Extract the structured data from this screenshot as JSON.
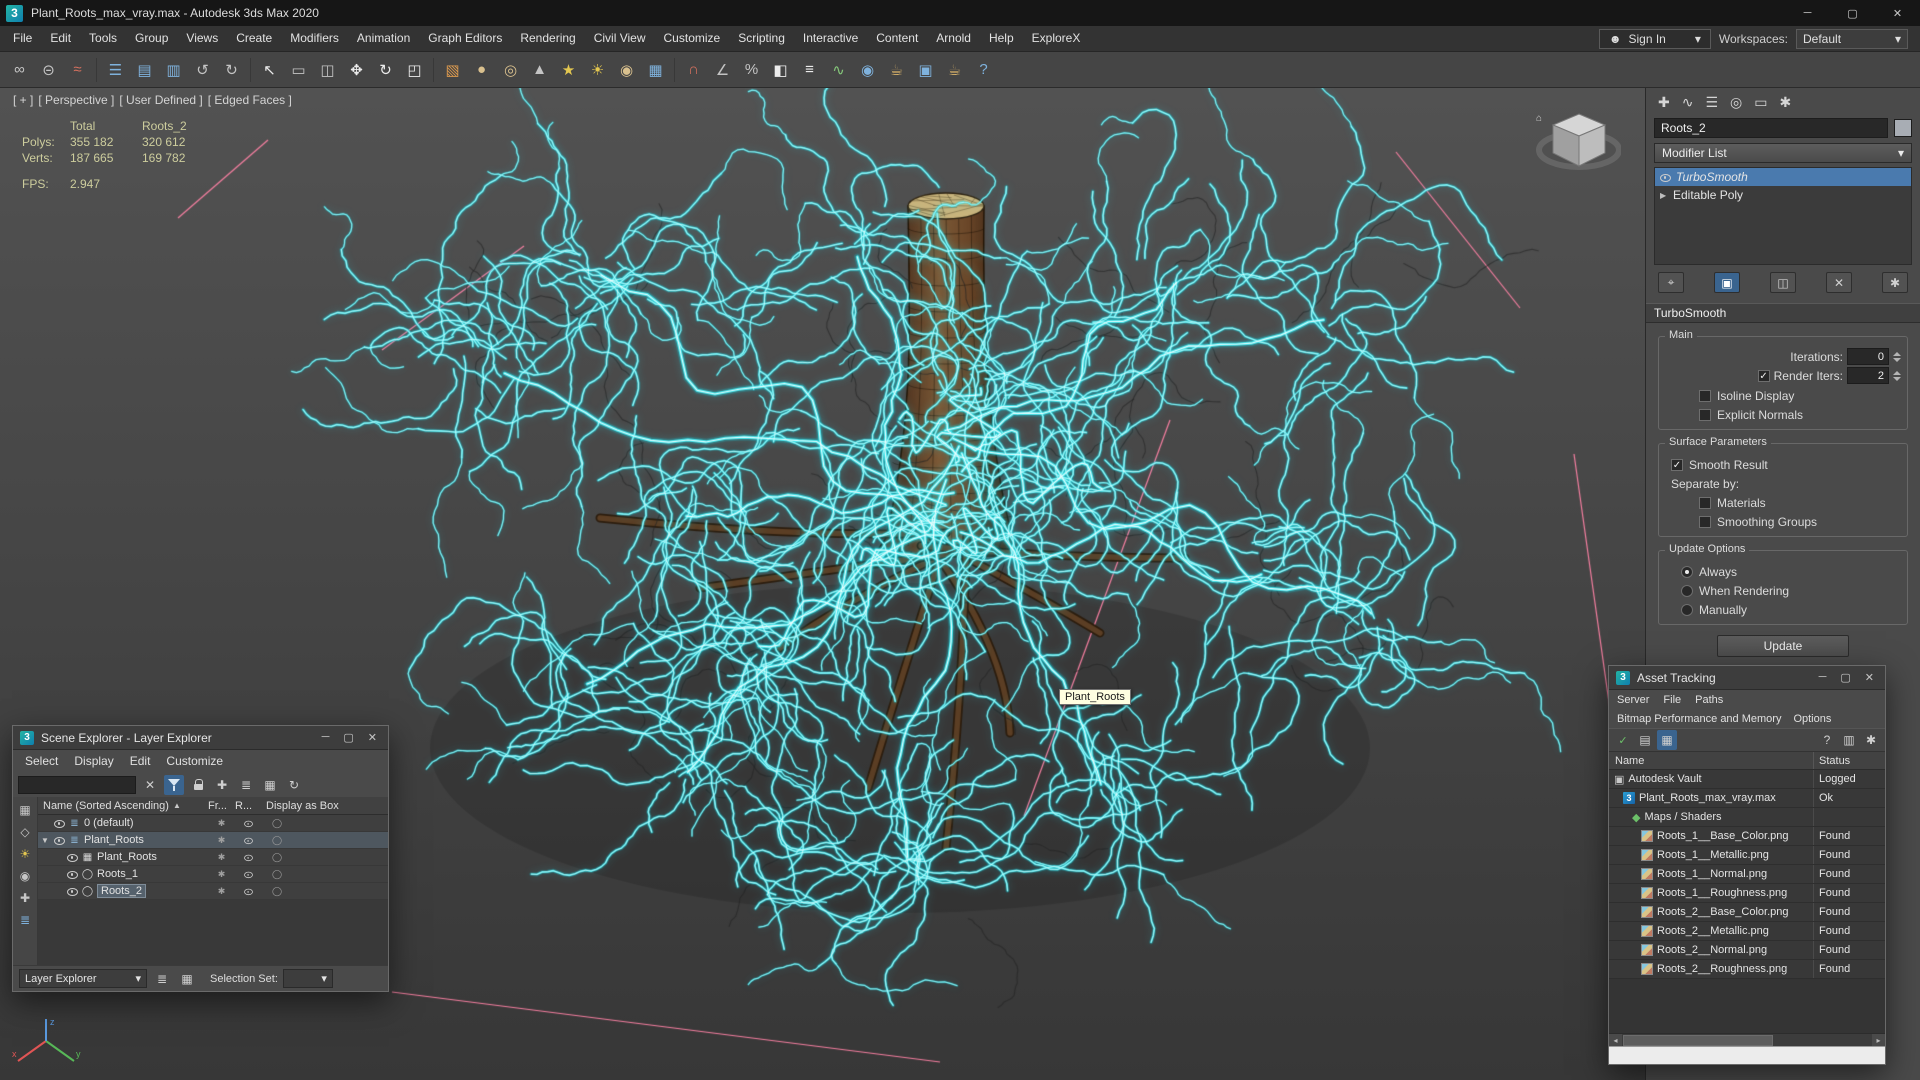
{
  "icons": {
    "app": "3",
    "minimize": "─",
    "maximize": "▢",
    "close": "✕",
    "dropdown": "▾",
    "user": "☻",
    "sort_asc": "▲",
    "expand_open": "▼",
    "expand_closed": "▶",
    "layer": "≣",
    "object_box": "▦",
    "object_circle": "◯",
    "frozen_dot": "✱",
    "display_box_dot": "◯",
    "clear": "✕",
    "plus": "✚",
    "grid": "▦",
    "table1": "▤",
    "table2": "▥",
    "refresh": "↻",
    "star": "✱",
    "check": "✓",
    "vault": "▣",
    "maps": "◆",
    "scroll_left": "◂",
    "scroll_right": "▸",
    "help": "?",
    "home": "⌂",
    "tab_create": "✚",
    "tab_modify": "∿",
    "tab_hierarchy": "☰",
    "tab_motion": "◎",
    "tab_display": "▭",
    "tab_utilities": "✱",
    "pin": "⌖",
    "end_result": "▣",
    "make_unique": "◫",
    "remove_modifier": "✕",
    "configure_sets": "✱",
    "geometry": "▦",
    "shapes": "◇",
    "lights": "☀",
    "cameras": "◉",
    "helpers": "✚"
  },
  "window": {
    "title": "Plant_Roots_max_vray.max - Autodesk 3ds Max 2020"
  },
  "menu_bar": {
    "items": [
      "File",
      "Edit",
      "Tools",
      "Group",
      "Views",
      "Create",
      "Modifiers",
      "Animation",
      "Graph Editors",
      "Rendering",
      "Civil View",
      "Customize",
      "Scripting",
      "Interactive",
      "Content",
      "Arnold",
      "Help",
      "ExploreX"
    ],
    "sign_in": "Sign In",
    "workspaces_label": "Workspaces:",
    "workspace_value": "Default"
  },
  "toolbar": {
    "glyphs": [
      "∞",
      "⊝",
      "≈",
      "☰",
      "▤",
      "▥",
      "↺",
      "↻",
      "↖",
      "▭",
      "◫",
      "✥",
      "↻",
      "◰",
      "▧",
      "●",
      "◎",
      "▲",
      "★",
      "☀",
      "◉",
      "▦",
      "∩",
      "∠",
      "%",
      "◧",
      "≡",
      "∿",
      "◉",
      "☕",
      "▣",
      "☕",
      "?"
    ]
  },
  "viewport": {
    "label_parts": [
      "[ + ]",
      "[ Perspective ]",
      "[ User Defined ]",
      "[ Edged Faces ]"
    ],
    "stats": {
      "headers": [
        "Total",
        "Roots_2"
      ],
      "rows": [
        [
          "Polys:",
          "355 182",
          "320 612"
        ],
        [
          "Verts:",
          "187 665",
          "169 782"
        ]
      ],
      "fps_label": "FPS:",
      "fps_value": "2.947"
    },
    "tooltip": "Plant_Roots"
  },
  "command_panel": {
    "object_name": "Roots_2",
    "modifier_list_label": "Modifier List",
    "stack": [
      {
        "label": "TurboSmooth"
      },
      {
        "label": "Editable Poly"
      }
    ],
    "rollout": {
      "title": "TurboSmooth",
      "main_label": "Main",
      "iterations_label": "Iterations:",
      "iterations_value": "0",
      "render_iters_label": "Render Iters:",
      "render_iters_value": "2",
      "isoline_label": "Isoline Display",
      "explicit_label": "Explicit Normals",
      "surface_label": "Surface Parameters",
      "smooth_result_label": "Smooth Result",
      "separate_by_label": "Separate by:",
      "materials_label": "Materials",
      "smoothing_groups_label": "Smoothing Groups",
      "update_label": "Update Options",
      "always_label": "Always",
      "when_rendering_label": "When Rendering",
      "manually_label": "Manually",
      "update_button": "Update"
    }
  },
  "scene_explorer": {
    "title": "Scene Explorer - Layer Explorer",
    "menus": [
      "Select",
      "Display",
      "Edit",
      "Customize"
    ],
    "columns": [
      "Name (Sorted Ascending)",
      "Fr...",
      "R...",
      "Display as Box"
    ],
    "rows": [
      {
        "name": "0 (default)"
      },
      {
        "name": "Plant_Roots"
      },
      {
        "name": "Plant_Roots"
      },
      {
        "name": "Roots_1"
      },
      {
        "name": "Roots_2"
      }
    ],
    "footer": {
      "mode": "Layer Explorer",
      "selection_set_label": "Selection Set:"
    }
  },
  "asset_tracking": {
    "title": "Asset Tracking",
    "menus": [
      "Server",
      "File",
      "Paths"
    ],
    "menus2": [
      "Bitmap Performance and Memory",
      "Options"
    ],
    "columns": [
      "Name",
      "Status"
    ],
    "rows": [
      {
        "name": "Autodesk Vault",
        "status": "Logged"
      },
      {
        "name": "Plant_Roots_max_vray.max",
        "status": "Ok"
      },
      {
        "name": "Maps / Shaders",
        "status": ""
      },
      {
        "name": "Roots_1__Base_Color.png",
        "status": "Found"
      },
      {
        "name": "Roots_1__Metallic.png",
        "status": "Found"
      },
      {
        "name": "Roots_1__Normal.png",
        "status": "Found"
      },
      {
        "name": "Roots_1__Roughness.png",
        "status": "Found"
      },
      {
        "name": "Roots_2__Base_Color.png",
        "status": "Found"
      },
      {
        "name": "Roots_2__Metallic.png",
        "status": "Found"
      },
      {
        "name": "Roots_2__Normal.png",
        "status": "Found"
      },
      {
        "name": "Roots_2__Roughness.png",
        "status": "Found"
      }
    ]
  }
}
